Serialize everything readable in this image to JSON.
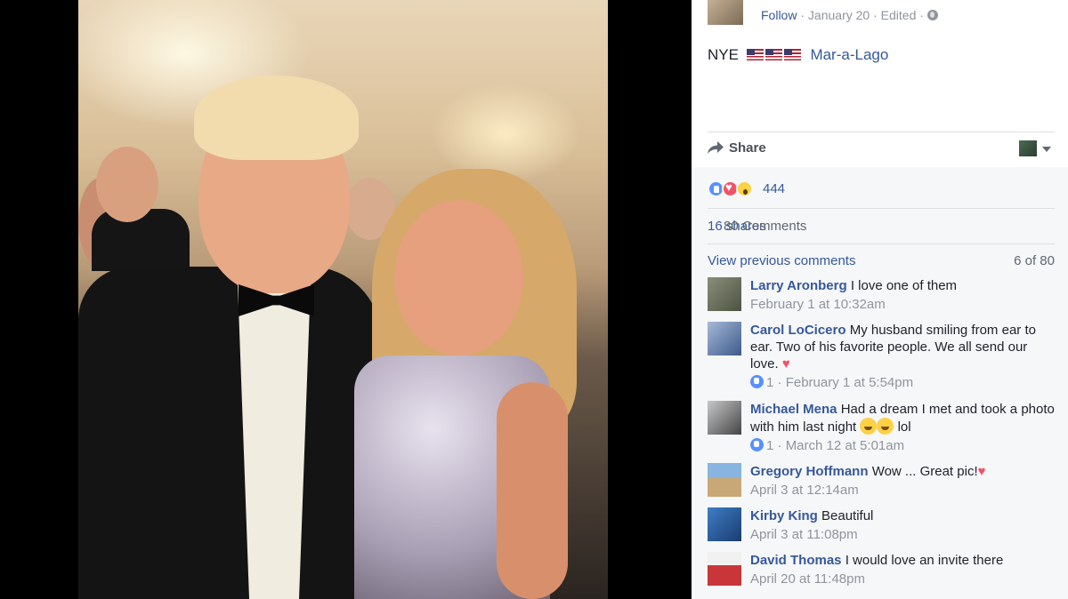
{
  "post": {
    "follow_label": "Follow",
    "date": "January 20",
    "edited": "Edited",
    "text": "NYE",
    "flags": [
      "us-flag",
      "us-flag",
      "us-flag"
    ],
    "location_link": "Mar-a-Lago"
  },
  "actions": {
    "share_label": "Share"
  },
  "reactions": {
    "types": [
      "like",
      "love",
      "wow"
    ],
    "count": "444"
  },
  "stats": {
    "shares": "16 shares",
    "comments": "80 Comments"
  },
  "comments_section": {
    "view_previous": "View previous comments",
    "pager": "6 of 80",
    "items": [
      {
        "author": "Larry Aronberg",
        "text": "I love one of them",
        "time": "February 1 at 10:32am",
        "likes": ""
      },
      {
        "author": "Carol LoCicero",
        "text": "My husband smiling from ear to ear. Two of his favorite people. We all send our love.",
        "time": "February 1 at 5:54pm",
        "likes": "1"
      },
      {
        "author": "Michael Mena",
        "text": "Had a dream I met and took a photo with him last night",
        "text_after": "lol",
        "time": "March 12 at 5:01am",
        "likes": "1"
      },
      {
        "author": "Gregory Hoffmann",
        "text": "Wow ... Great pic!",
        "time": "April 3 at 12:14am",
        "likes": ""
      },
      {
        "author": "Kirby King",
        "text": "Beautiful",
        "time": "April 3 at 11:08pm",
        "likes": ""
      },
      {
        "author": "David Thomas",
        "text": "I would love an invite there",
        "time": "April 20 at 11:48pm",
        "likes": ""
      }
    ]
  },
  "colors": {
    "link": "#365899",
    "meta": "#90949c",
    "like": "#5890ff",
    "love": "#f25268",
    "wow": "#fcd144"
  }
}
